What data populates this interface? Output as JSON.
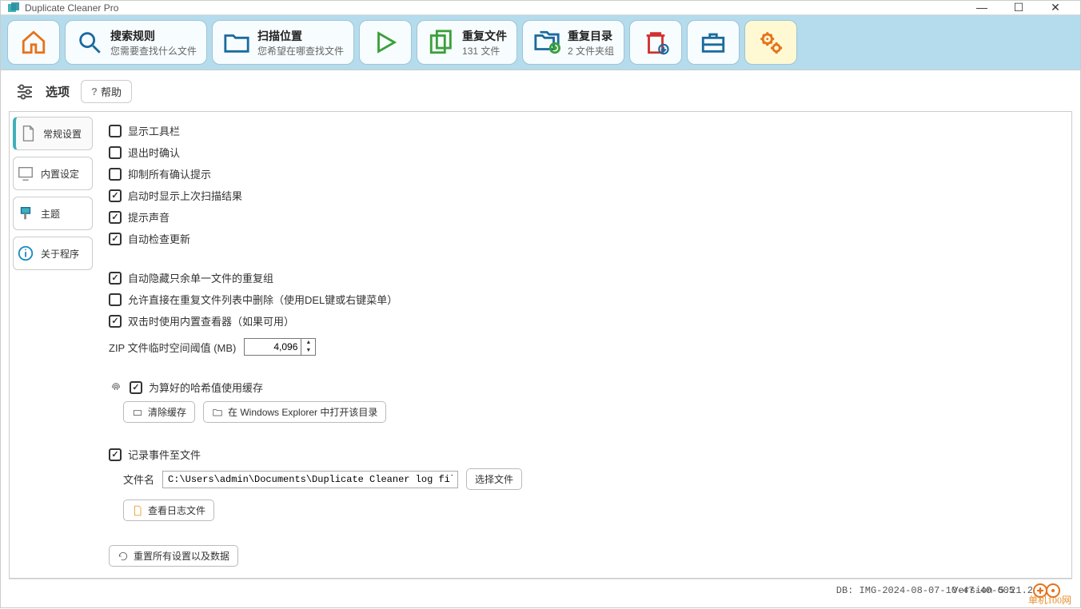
{
  "window_title": "Duplicate Cleaner Pro",
  "toolbar": {
    "home": "",
    "search_rules": {
      "title": "搜索规则",
      "sub": "您需要查找什么文件"
    },
    "scan_location": {
      "title": "扫描位置",
      "sub": "您希望在哪查找文件"
    },
    "play": "",
    "dup_files": {
      "title": "重复文件",
      "sub": "131 文件"
    },
    "dup_folders": {
      "title": "重复目录",
      "sub": "2 文件夹组"
    }
  },
  "page": {
    "title": "选项",
    "help": "帮助"
  },
  "sidebar": {
    "general": "常规设置",
    "builtin": "内置设定",
    "theme": "主题",
    "about": "关于程序"
  },
  "options": {
    "show_toolbar": "显示工具栏",
    "exit_confirm": "退出时确认",
    "suppress_confirm": "抑制所有确认提示",
    "show_last_scan": "启动时显示上次扫描结果",
    "alert_sound": "提示声音",
    "auto_update": "自动检查更新",
    "auto_hide_single": "自动隐藏只余单一文件的重复组",
    "allow_direct_delete": "允许直接在重复文件列表中删除（使用DEL键或右键菜单）",
    "dblclick_viewer": "双击时使用内置查看器（如果可用）",
    "zip_label": "ZIP 文件临时空间阈值 (MB)",
    "zip_value": "4,096",
    "hash_cache": "为算好的哈希值使用缓存",
    "clear_cache": "清除缓存",
    "open_explorer": "在 Windows Explorer 中打开该目录",
    "log_events": "记录事件至文件",
    "filename_label": "文件名",
    "filename_value": "C:\\Users\\admin\\Documents\\Duplicate Cleaner log file.txt",
    "choose_file": "选择文件",
    "view_log": "查看日志文件",
    "reset_all": "重置所有设置以及数据"
  },
  "statusbar": {
    "db": "DB: IMG-2024-08-07-10-47-40-605",
    "version": "Version 5.21.2",
    "watermark": "单机100网"
  }
}
